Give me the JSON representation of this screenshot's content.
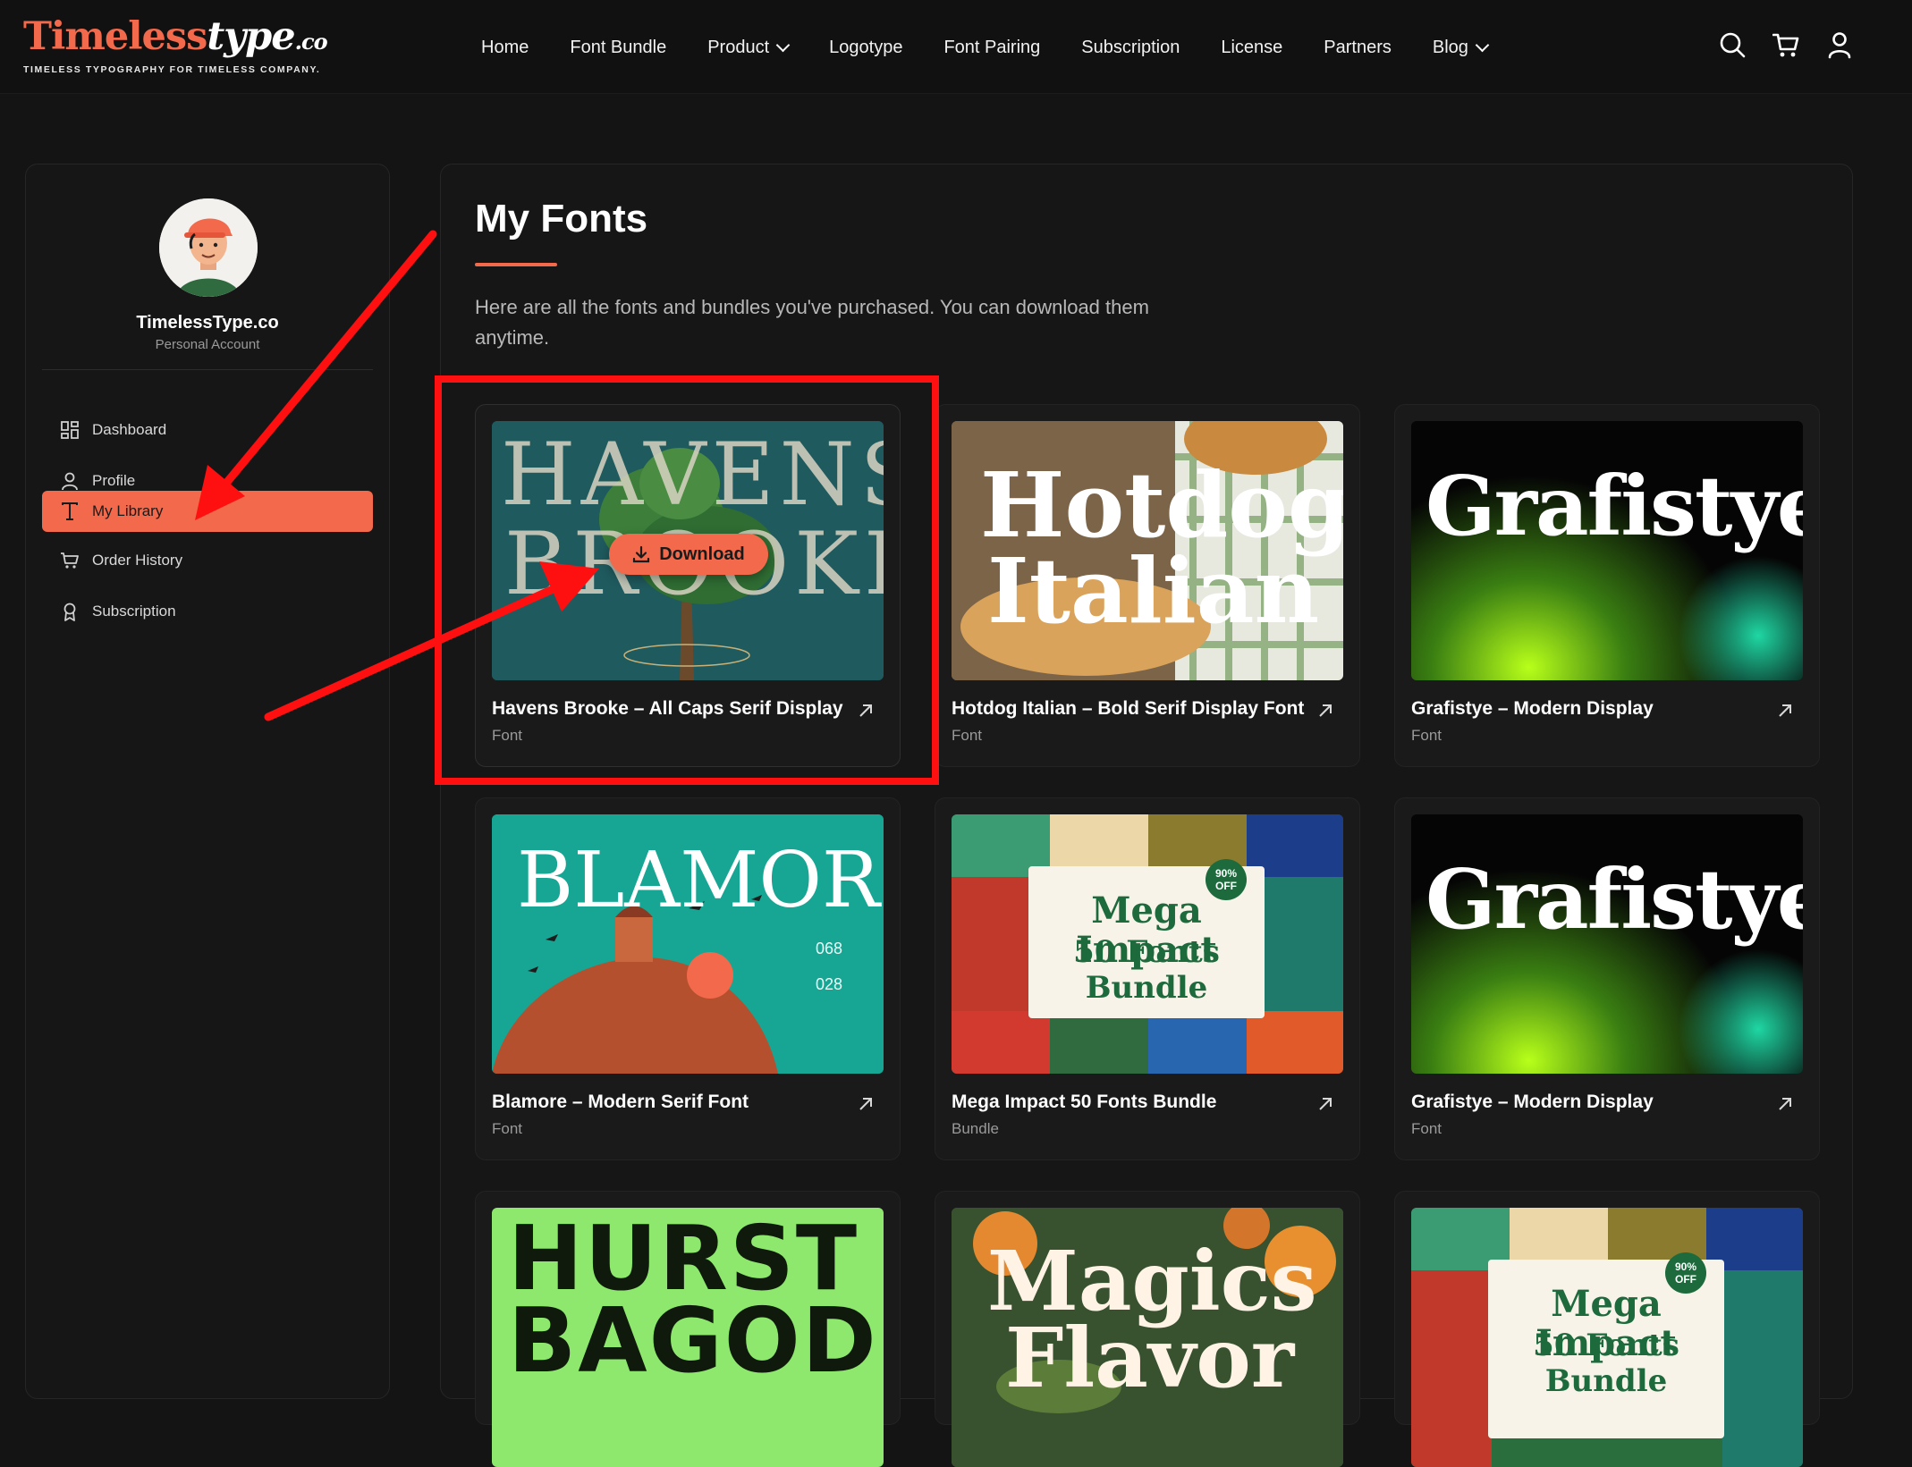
{
  "header": {
    "logo": {
      "word_part_1": "Timeless",
      "word_part_2": "type",
      "word_part_3": ".co",
      "tagline": "TIMELESS TYPOGRAPHY FOR TIMELESS COMPANY."
    },
    "nav": [
      {
        "label": "Home"
      },
      {
        "label": "Font Bundle"
      },
      {
        "label": "Product",
        "has_dropdown": true
      },
      {
        "label": "Logotype"
      },
      {
        "label": "Font Pairing"
      },
      {
        "label": "Subscription"
      },
      {
        "label": "License"
      },
      {
        "label": "Partners"
      },
      {
        "label": "Blog",
        "has_dropdown": true
      }
    ],
    "icons": [
      "search-icon",
      "cart-icon",
      "user-icon"
    ]
  },
  "sidebar": {
    "account_name": "TimelessType.co",
    "account_type": "Personal Account",
    "menu": [
      {
        "label": "Dashboard",
        "icon": "dashboard-icon"
      },
      {
        "label": "Profile",
        "icon": "user-icon"
      },
      {
        "label": "My Library",
        "icon": "type-icon",
        "active": true
      },
      {
        "label": "Order History",
        "icon": "cart-icon"
      },
      {
        "label": "Subscription",
        "icon": "badge-icon"
      }
    ]
  },
  "main": {
    "title": "My Fonts",
    "intro": "Here are all the fonts and bundles you've purchased. You can download them anytime.",
    "download_label": "Download",
    "items": [
      {
        "title": "Havens Brooke – All Caps Serif Display",
        "type": "Font",
        "art_line_1": "HAVENS",
        "art_line_2": "BROOKE"
      },
      {
        "title": "Hotdog Italian – Bold Serif Display Font",
        "type": "Font",
        "art_line_1": "Hotdog",
        "art_line_2": "Italian"
      },
      {
        "title": "Grafistye – Modern Display",
        "type": "Font",
        "art_line_1": "Grafistye"
      },
      {
        "title": "Blamore – Modern Serif Font",
        "type": "Font",
        "art_line_1": "BLAMORE",
        "art_stat_1": "068",
        "art_stat_2": "028"
      },
      {
        "title": "Mega Impact 50 Fonts Bundle",
        "type": "Bundle",
        "art_line_1": "Mega Impact",
        "art_line_2": "50 Fonts Bundle",
        "art_badge": "90% OFF"
      },
      {
        "title": "Grafistye – Modern Display",
        "type": "Font",
        "art_line_1": "Grafistye"
      },
      {
        "art_line_1": "HURST",
        "art_line_2": "BAGOD"
      },
      {
        "art_line_1": "Magics",
        "art_line_2": "Flavor"
      },
      {
        "art_line_1": "Mega Impact",
        "art_line_2": "50 Fonts Bundle",
        "art_badge": "90% OFF"
      }
    ]
  },
  "colors": {
    "accent": "#f26a4b",
    "annotation_red": "#ff1010",
    "background": "#141414"
  }
}
